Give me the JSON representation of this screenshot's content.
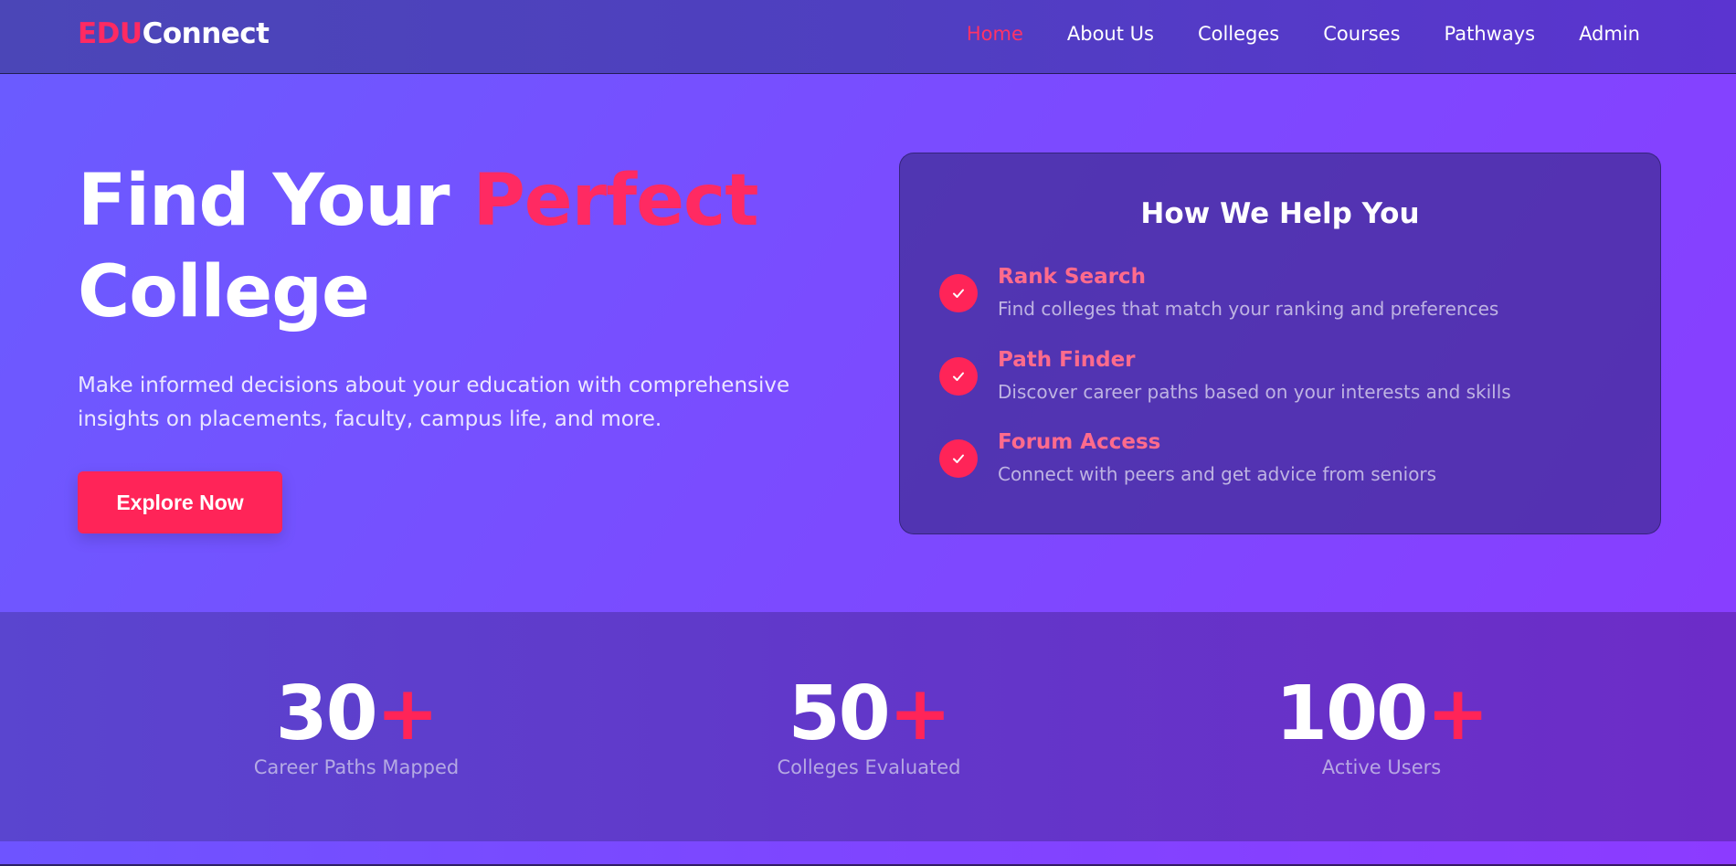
{
  "brand": {
    "prefix": "EDU",
    "suffix": "Connect"
  },
  "nav": {
    "items": [
      {
        "label": "Home"
      },
      {
        "label": "About Us"
      },
      {
        "label": "Colleges"
      },
      {
        "label": "Courses"
      },
      {
        "label": "Pathways"
      },
      {
        "label": "Admin"
      }
    ],
    "active": "Home"
  },
  "hero": {
    "title_part1": "Find Your ",
    "title_accent": "Perfect",
    "title_part2": "College",
    "subtitle": "Make informed decisions about your education with comprehensive insights on placements, faculty, campus life, and more.",
    "cta_label": "Explore Now"
  },
  "help": {
    "title": "How We Help You",
    "items": [
      {
        "title": "Rank Search",
        "description": "Find colleges that match your ranking and preferences",
        "icon": "check-icon"
      },
      {
        "title": "Path Finder",
        "description": "Discover career paths based on your interests and skills",
        "icon": "check-icon"
      },
      {
        "title": "Forum Access",
        "description": "Connect with peers and get advice from seniors",
        "icon": "check-icon"
      }
    ]
  },
  "stats": [
    {
      "value": "30",
      "suffix": "+",
      "label": "Career Paths Mapped"
    },
    {
      "value": "50",
      "suffix": "+",
      "label": "Colleges Evaluated"
    },
    {
      "value": "100",
      "suffix": "+",
      "label": "Active Users"
    }
  ],
  "colors": {
    "accent": "#ff2458",
    "accent_text": "#ff6b8c",
    "nav_active": "#ff3366"
  }
}
